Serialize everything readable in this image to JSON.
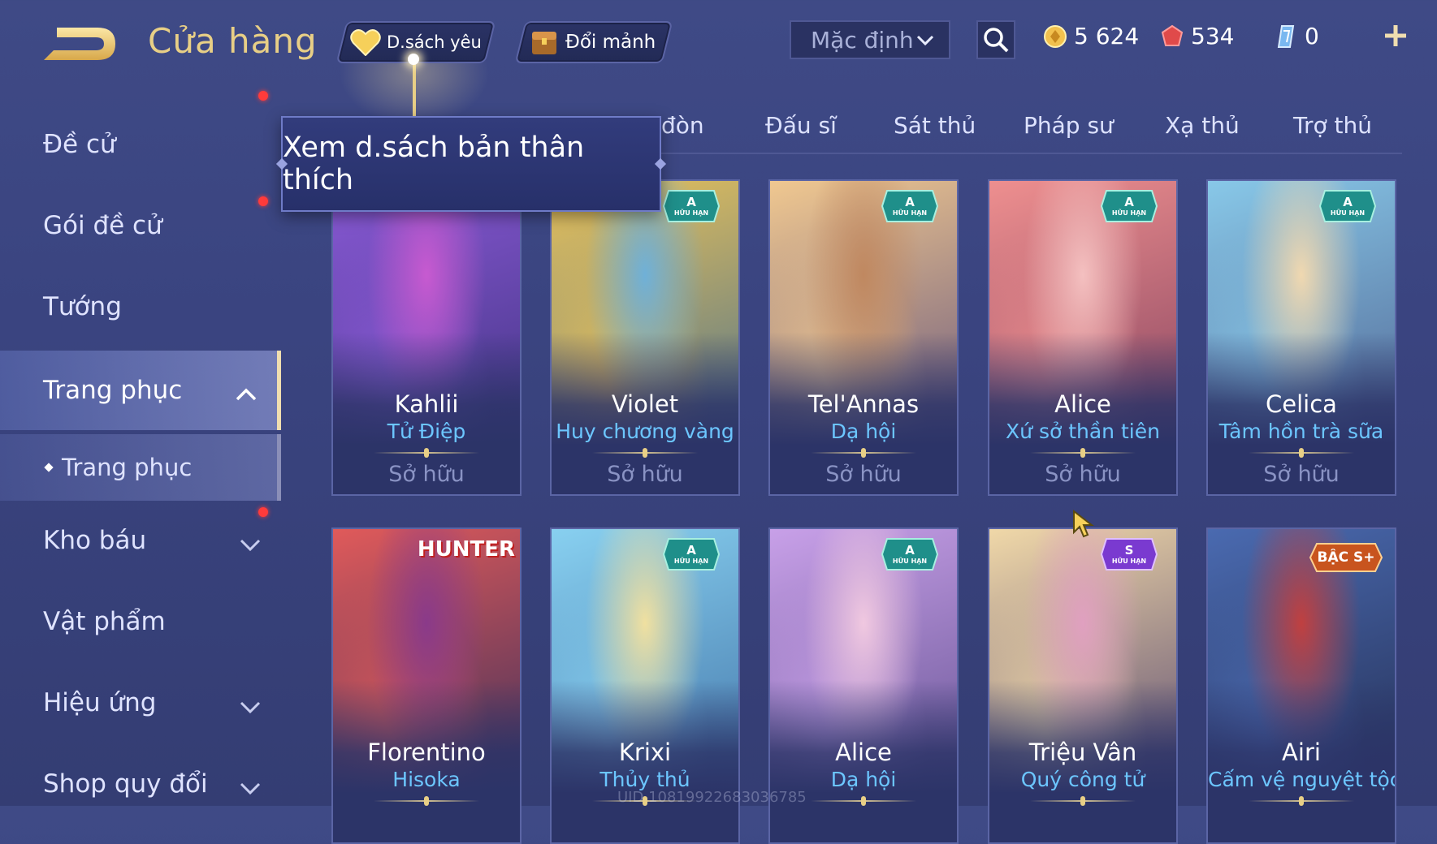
{
  "header": {
    "title": "Cửa hàng",
    "favorites_label": "D.sách yêu",
    "shard_label": "Đổi mảnh",
    "sort_value": "Mặc định",
    "currencies": [
      {
        "name": "gold",
        "value": "5 624",
        "icon": "gold-coin-icon"
      },
      {
        "name": "voucher",
        "value": "534",
        "icon": "red-gem-icon"
      },
      {
        "name": "shard",
        "value": "0",
        "icon": "blue-crystal-icon"
      }
    ]
  },
  "tooltip": {
    "text": "Xem d.sách bản thân thích"
  },
  "sidebar": {
    "items": [
      {
        "label": "Đề cử"
      },
      {
        "label": "Gói đề cử"
      },
      {
        "label": "Tướng"
      },
      {
        "label": "Trang phục"
      },
      {
        "label": "Trang phục"
      },
      {
        "label": "Kho báu"
      },
      {
        "label": "Vật phẩm"
      },
      {
        "label": "Hiệu ứng"
      },
      {
        "label": "Shop quy đổi"
      }
    ]
  },
  "tabs": [
    {
      "label": "đòn"
    },
    {
      "label": "Đấu sĩ"
    },
    {
      "label": "Sát thủ"
    },
    {
      "label": "Pháp sư"
    },
    {
      "label": "Xạ thủ"
    },
    {
      "label": "Trợ thủ"
    }
  ],
  "badges": {
    "grade_a": "A",
    "grade_s": "S",
    "limited": "HỮU HẠN",
    "rank": "BẬC S+",
    "collab_logo": "HUNTER"
  },
  "skins": [
    {
      "hero": "Kahlii",
      "skin": "Tử Điệp",
      "status": "Sở hữu",
      "colors": [
        "#8a5ad6",
        "#c75ad0",
        "#3a2f7a"
      ]
    },
    {
      "hero": "Violet",
      "skin": "Huy chương vàng",
      "status": "Sở hữu",
      "colors": [
        "#e9c25a",
        "#6fb0d8",
        "#3f6a8f"
      ]
    },
    {
      "hero": "Tel'Annas",
      "skin": "Dạ hội",
      "status": "Sở hữu",
      "colors": [
        "#f0c890",
        "#c08860",
        "#5a4a7a"
      ]
    },
    {
      "hero": "Alice",
      "skin": "Xứ sở thần tiên",
      "status": "Sở hữu",
      "colors": [
        "#ee8f8f",
        "#f4c0c0",
        "#7a3a5a"
      ]
    },
    {
      "hero": "Celica",
      "skin": "Tâm hồn trà sữa",
      "status": "Sở hữu",
      "colors": [
        "#88c8e8",
        "#f0d8b0",
        "#4a5a8a"
      ]
    },
    {
      "hero": "Florentino",
      "skin": "Hisoka",
      "colors": [
        "#e05a5a",
        "#8a3a8a",
        "#2a2a5a"
      ]
    },
    {
      "hero": "Krixi",
      "skin": "Thủy thủ",
      "colors": [
        "#88d0f0",
        "#f0e0a0",
        "#3a6aa0"
      ]
    },
    {
      "hero": "Alice",
      "skin": "Dạ hội",
      "colors": [
        "#c8a0e8",
        "#f0c8e0",
        "#5a4a8a"
      ]
    },
    {
      "hero": "Triệu Vân",
      "skin": "Quý công tử",
      "colors": [
        "#f0d8a8",
        "#e0a0c0",
        "#4a3a6a"
      ]
    },
    {
      "hero": "Airi",
      "skin": "Cấm vệ nguyệt tộc",
      "colors": [
        "#4a6ab0",
        "#c04040",
        "#20284a"
      ]
    }
  ],
  "footer": {
    "uid": "UID 10819922683036785"
  }
}
